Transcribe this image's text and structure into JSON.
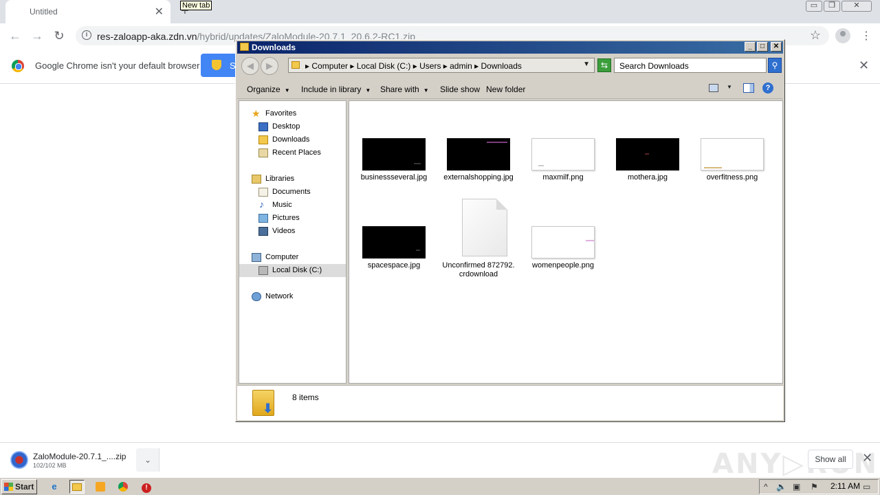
{
  "browser": {
    "tab_title": "Untitled",
    "tab_close": "✕",
    "new_tab_symbol": "+",
    "new_tab_tooltip": "New tab",
    "window_controls": [
      "▭",
      "❐",
      "✕"
    ],
    "url_host": "res-zaloapp-aka.zdn.vn",
    "url_path": "/hybrid/updates/ZaloModule-20.7.1_20.6.2-RC1.zip",
    "back_symbol": "←",
    "forward_symbol": "→",
    "reload_symbol": "↻",
    "bookmark_symbol": "☆",
    "menu_symbol": "⋮",
    "infobar_message": "Google Chrome isn't your default browser",
    "infobar_button": "S",
    "infobar_close": "✕"
  },
  "download_shelf": {
    "file_name": "ZaloModule-20.7.1_....zip",
    "file_size": "102/102 MB",
    "chevron": "⌄",
    "show_all": "Show all",
    "close": "✕",
    "watermark": "ANY▷RUN"
  },
  "explorer": {
    "title": "Downloads",
    "title_buttons": [
      "_",
      "□",
      "✕"
    ],
    "breadcrumbs": "▸  Computer  ▸  Local Disk (C:)  ▸  Users  ▸  admin  ▸  Downloads",
    "address_dropdown": "▼",
    "search_placeholder": "Search Downloads",
    "toolbar": {
      "organize": "Organize",
      "include_in_library": "Include in library",
      "share_with": "Share with",
      "slide_show": "Slide show",
      "new_folder": "New folder",
      "dropdown_arrow": "▼",
      "help": "?"
    },
    "nav": {
      "favorites": "Favorites",
      "desktop": "Desktop",
      "downloads": "Downloads",
      "recent_places": "Recent Places",
      "libraries": "Libraries",
      "documents": "Documents",
      "music": "Music",
      "pictures": "Pictures",
      "videos": "Videos",
      "computer": "Computer",
      "local_disk": "Local Disk (C:)",
      "network": "Network"
    },
    "files": [
      {
        "name": "businessseveral.jpg",
        "thumb": "dark"
      },
      {
        "name": "externalshopping.jpg",
        "thumb": "dark"
      },
      {
        "name": "maxmilf.png",
        "thumb": "light"
      },
      {
        "name": "mothera.jpg",
        "thumb": "dark"
      },
      {
        "name": "overfitness.png",
        "thumb": "light"
      },
      {
        "name": "spacespace.jpg",
        "thumb": "dark"
      },
      {
        "name": "Unconfirmed 872792.crdownload",
        "thumb": "document"
      },
      {
        "name": "womenpeople.png",
        "thumb": "light"
      }
    ],
    "item_count": "8 items"
  },
  "taskbar": {
    "start_label": "Start",
    "clock": "2:11 AM"
  },
  "colors": {
    "titlebar_start": "#0a246a",
    "chrome_blue": "#4285f4",
    "taskbar": "#d4d0c8"
  }
}
